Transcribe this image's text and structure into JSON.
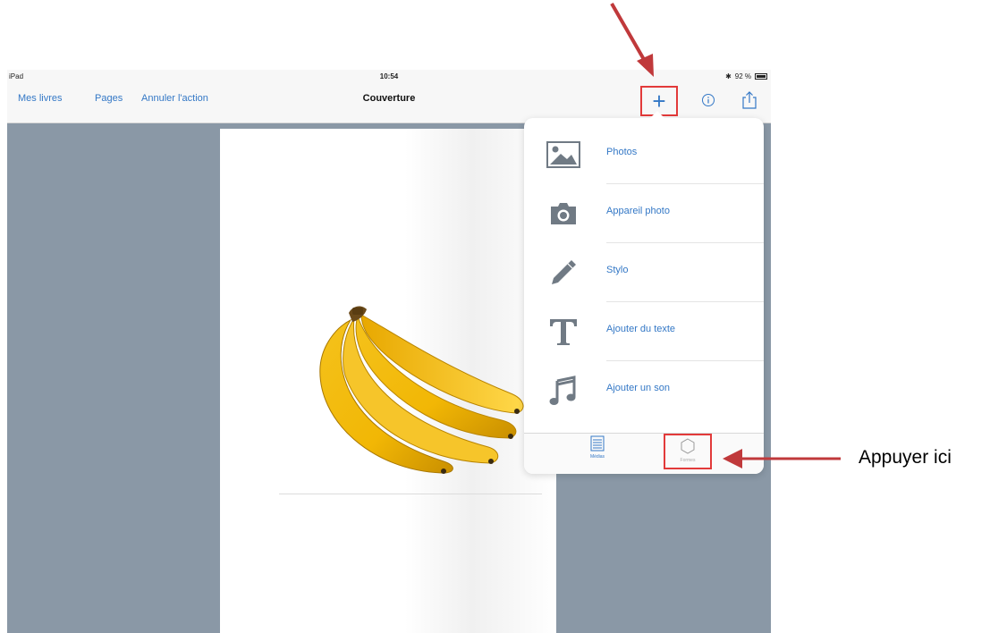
{
  "status_bar": {
    "device": "iPad",
    "wifi_icon": "wifi-icon",
    "time": "10:54",
    "bluetooth": "✱",
    "battery_text": "92 %"
  },
  "nav": {
    "my_books": "Mes livres",
    "pages": "Pages",
    "undo": "Annuler l'action",
    "title": "Couverture",
    "plus_label": "+",
    "info_icon": "info-icon",
    "share_icon": "share-icon"
  },
  "popover": {
    "items": [
      {
        "label": "Photos",
        "icon": "photo-icon"
      },
      {
        "label": "Appareil photo",
        "icon": "camera-icon"
      },
      {
        "label": "Stylo",
        "icon": "pen-icon"
      },
      {
        "label": "Ajouter du texte",
        "icon": "text-icon"
      },
      {
        "label": "Ajouter un son",
        "icon": "music-note-icon"
      }
    ],
    "tabs": [
      {
        "label": "Médias",
        "icon": "media-list-icon"
      },
      {
        "label": "Formes",
        "icon": "shape-icon"
      }
    ]
  },
  "annotation": {
    "text": "Appuyer ici"
  },
  "colors": {
    "accent": "#3478c6",
    "highlight": "#e23a3a",
    "arrow": "#c0393b",
    "workspace": "#8a98a6"
  }
}
